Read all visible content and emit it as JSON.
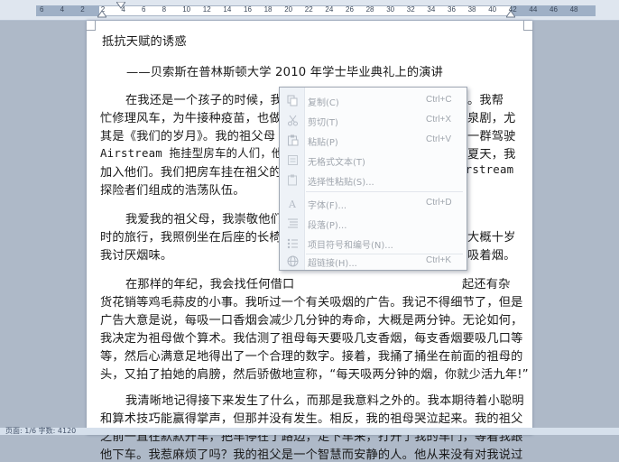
{
  "ruler": {
    "labels": [
      "6",
      "4",
      "2",
      "2",
      "4",
      "6",
      "8",
      "10",
      "12",
      "14",
      "16",
      "18",
      "20",
      "22",
      "24",
      "26",
      "28",
      "30",
      "32",
      "34",
      "36",
      "38",
      "40",
      "42",
      "44",
      "46",
      "48"
    ]
  },
  "document": {
    "title": "抵抗天赋的诱惑",
    "subtitle": "——贝索斯在普林斯顿大学 2010 年学士毕业典礼上的演讲",
    "lines": [
      "在我还是一个孩子的时候，我的",
      "忙修理风车，为牛接种疫苗，也做",
      "其是《我们的岁月》。我的祖父母",
      "Airstream 拖挂型房车的人们，他们",
      "加入他们。我们把房车挂在祖父的",
      "探险者们组成的浩荡队伍。",
      "我爱我的祖父母，我崇敬他们，",
      "时的旅行，我照例坐在后座的长椅",
      "我讨厌烟味。",
      "在那样的年纪，我会找任何借口",
      "货花销等鸡毛蒜皮的小事。我听过一个有关吸烟的广告。我记不得细节了，但是",
      "广告大意是说，每吸一口香烟会减少几分钟的寿命，大概是两分钟。无论如何，",
      "我决定为祖母做个算术。我估测了祖母每天要吸几支香烟，每支香烟要吸几口等",
      "等，然后心满意足地得出了一个合理的数字。接着，我捅了捅坐在前面的祖母的",
      "头，又拍了拍她的肩膀，然后骄傲地宣称，“每天吸两分钟的烟，你就少活九年!”",
      "我清晰地记得接下来发生了什么，而那是我意料之外的。我本期待着小聪明",
      "和算术技巧能赢得掌声，但那并没有发生。相反，我的祖母哭泣起来。我的祖父",
      "之前一直在默默开车，把车停在了路边，走下车来，打开了我的车门，等着我跟",
      "他下车。我惹麻烦了吗？我的祖父是一个智慧而安静的人。他从来没有对我说过"
    ],
    "right_fragments": [
      "。我帮",
      "泉剧，尤",
      "一群驾驶",
      "夏天，我",
      "irstream",
      "大概十岁",
      "吸着烟。",
      "起还有杂"
    ]
  },
  "context_menu": {
    "items": [
      {
        "label": "复制(C)",
        "shortcut": "Ctrl+C",
        "icon": "copy-icon"
      },
      {
        "label": "剪切(T)",
        "shortcut": "Ctrl+X",
        "icon": "scissors-icon"
      },
      {
        "label": "粘贴(P)",
        "shortcut": "Ctrl+V",
        "icon": "paste-icon"
      },
      {
        "label": "无格式文本(T)",
        "shortcut": "",
        "icon": "plain-text-icon"
      },
      {
        "label": "选择性粘贴(S)...",
        "shortcut": "",
        "icon": "paste-special-icon"
      },
      {
        "label": "字体(F)...",
        "shortcut": "Ctrl+D",
        "icon": "font-icon"
      },
      {
        "label": "段落(P)...",
        "shortcut": "",
        "icon": "paragraph-icon"
      },
      {
        "label": "项目符号和编号(N)...",
        "shortcut": "",
        "icon": "bullets-icon"
      },
      {
        "label": "超链接(H)...",
        "shortcut": "Ctrl+K",
        "icon": "hyperlink-icon"
      }
    ]
  },
  "status_bar": {
    "text": "页面: 1/6  字数: 4120"
  }
}
